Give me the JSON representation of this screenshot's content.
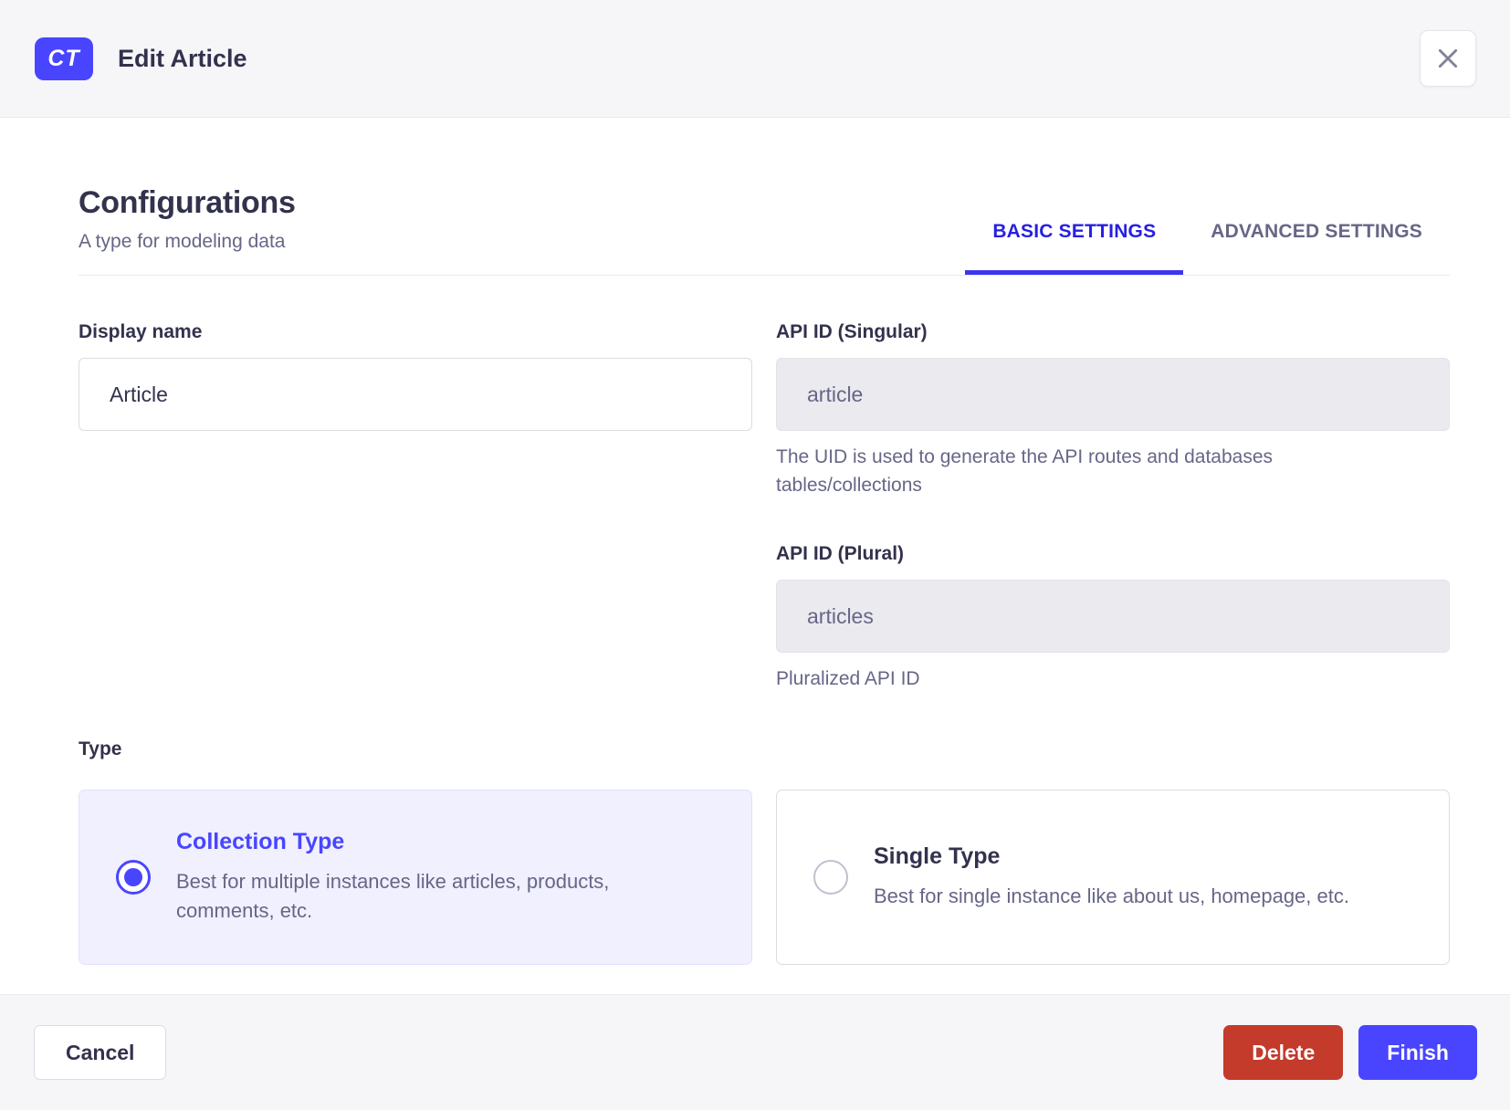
{
  "header": {
    "badge": "CT",
    "title": "Edit Article"
  },
  "section": {
    "title": "Configurations",
    "subtitle": "A type for modeling data"
  },
  "tabs": [
    {
      "label": "BASIC SETTINGS",
      "active": true
    },
    {
      "label": "ADVANCED SETTINGS",
      "active": false
    }
  ],
  "form": {
    "display_name": {
      "label": "Display name",
      "value": "Article"
    },
    "api_id_singular": {
      "label": "API ID (Singular)",
      "value": "article",
      "disabled": true,
      "helper": "The UID is used to generate the API routes and databases tables/collections"
    },
    "api_id_plural": {
      "label": "API ID (Plural)",
      "value": "articles",
      "disabled": true,
      "helper": "Pluralized API ID"
    },
    "type": {
      "label": "Type",
      "options": [
        {
          "title": "Collection Type",
          "description": "Best for multiple instances like articles, products, comments, etc.",
          "selected": true
        },
        {
          "title": "Single Type",
          "description": "Best for single instance like about us, homepage, etc.",
          "selected": false
        }
      ]
    }
  },
  "footer": {
    "cancel_label": "Cancel",
    "delete_label": "Delete",
    "finish_label": "Finish"
  },
  "icons": {
    "close": "close-icon"
  },
  "colors": {
    "primary": "#4945ff",
    "primary_tab_text": "#271fe0",
    "primary_light_bg": "#f0f0ff",
    "danger": "#c43a2b",
    "text_dark": "#32324d",
    "text_muted": "#666687",
    "surface_gray": "#f6f6f9",
    "border": "#dcdce4",
    "disabled_bg": "#eaeaef"
  }
}
